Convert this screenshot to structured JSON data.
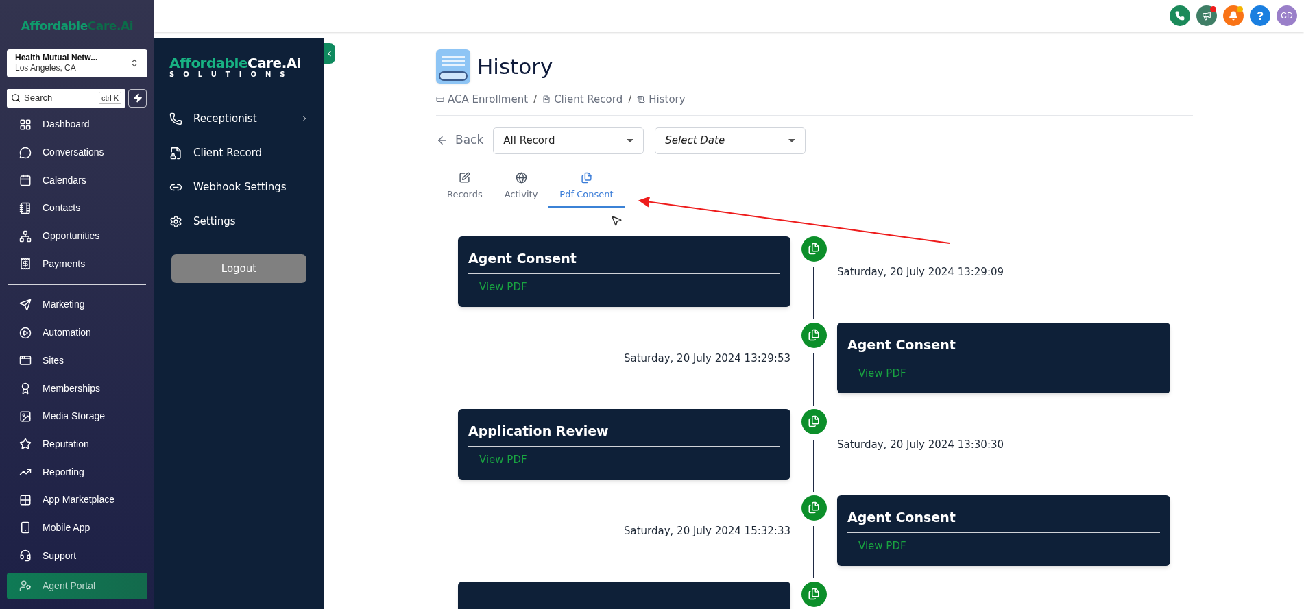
{
  "sidebar": {
    "logo": {
      "part_1": "Affordable",
      "part_2": "Care.Ai"
    },
    "account": {
      "name": "Health Mutual Netw...",
      "location": "Los Angeles, CA"
    },
    "search": {
      "placeholder": "Search",
      "shortcut": "ctrl K"
    },
    "items_top": [
      {
        "label": "Dashboard",
        "selected": false
      },
      {
        "label": "Conversations",
        "selected": false
      },
      {
        "label": "Calendars",
        "selected": false
      },
      {
        "label": "Contacts",
        "selected": false
      },
      {
        "label": "Opportunities",
        "selected": false
      },
      {
        "label": "Payments",
        "selected": false
      }
    ],
    "items_bottom": [
      {
        "label": "Marketing",
        "selected": false
      },
      {
        "label": "Automation",
        "selected": false
      },
      {
        "label": "Sites",
        "selected": false
      },
      {
        "label": "Memberships",
        "selected": false
      },
      {
        "label": "Media Storage",
        "selected": false
      },
      {
        "label": "Reputation",
        "selected": false
      },
      {
        "label": "Reporting",
        "selected": false
      },
      {
        "label": "App Marketplace",
        "selected": false
      },
      {
        "label": "Mobile App",
        "selected": false
      },
      {
        "label": "Support",
        "selected": false
      },
      {
        "label": "Agent Portal",
        "selected": true
      }
    ]
  },
  "top_bar": {
    "actions": [
      {
        "kind": "phone"
      },
      {
        "kind": "megaphone",
        "badge": {
          "color": "#ef1c1c"
        }
      },
      {
        "kind": "bell",
        "badge": {
          "color": "#f5b400"
        }
      },
      {
        "kind": "help"
      }
    ],
    "avatar": "CD"
  },
  "app_menu": {
    "logo": {
      "part_1": "Affordable",
      "part_2": "Care.Ai",
      "tagline": "SOLUTIONS"
    },
    "items": [
      {
        "label": "Receptionist",
        "has_submenu": true
      },
      {
        "label": "Client Record",
        "has_submenu": false
      },
      {
        "label": "Webhook Settings",
        "has_submenu": false
      },
      {
        "label": "Settings",
        "has_submenu": false
      }
    ],
    "logout": "Logout"
  },
  "page": {
    "title": "History",
    "breadcrumbs": [
      {
        "label": "ACA Enrollment"
      },
      {
        "label": "Client Record"
      },
      {
        "label": "History"
      }
    ],
    "breadcrumb_separator": "/",
    "back": "Back",
    "record_filter": {
      "value": "All Record"
    },
    "date_filter": {
      "placeholder": "Select Date"
    },
    "tabs": [
      {
        "label": "Records",
        "selected": false
      },
      {
        "label": "Activity",
        "selected": false
      },
      {
        "label": "Pdf Consent",
        "selected": true
      }
    ],
    "timeline": [
      {
        "kind": "left",
        "title": "Agent Consent",
        "link": "View PDF",
        "timestamp": "Saturday, 20 July 2024 13:29:09"
      },
      {
        "kind": "right",
        "title": "Agent Consent",
        "link": "View PDF",
        "timestamp": "Saturday, 20 July 2024 13:29:53"
      },
      {
        "kind": "left",
        "title": "Application Review",
        "link": "View PDF",
        "timestamp": "Saturday, 20 July 2024 13:30:30"
      },
      {
        "kind": "right",
        "title": "Agent Consent",
        "link": "View PDF",
        "timestamp": "Saturday, 20 July 2024 15:32:33"
      },
      {
        "kind": "left"
      }
    ]
  }
}
